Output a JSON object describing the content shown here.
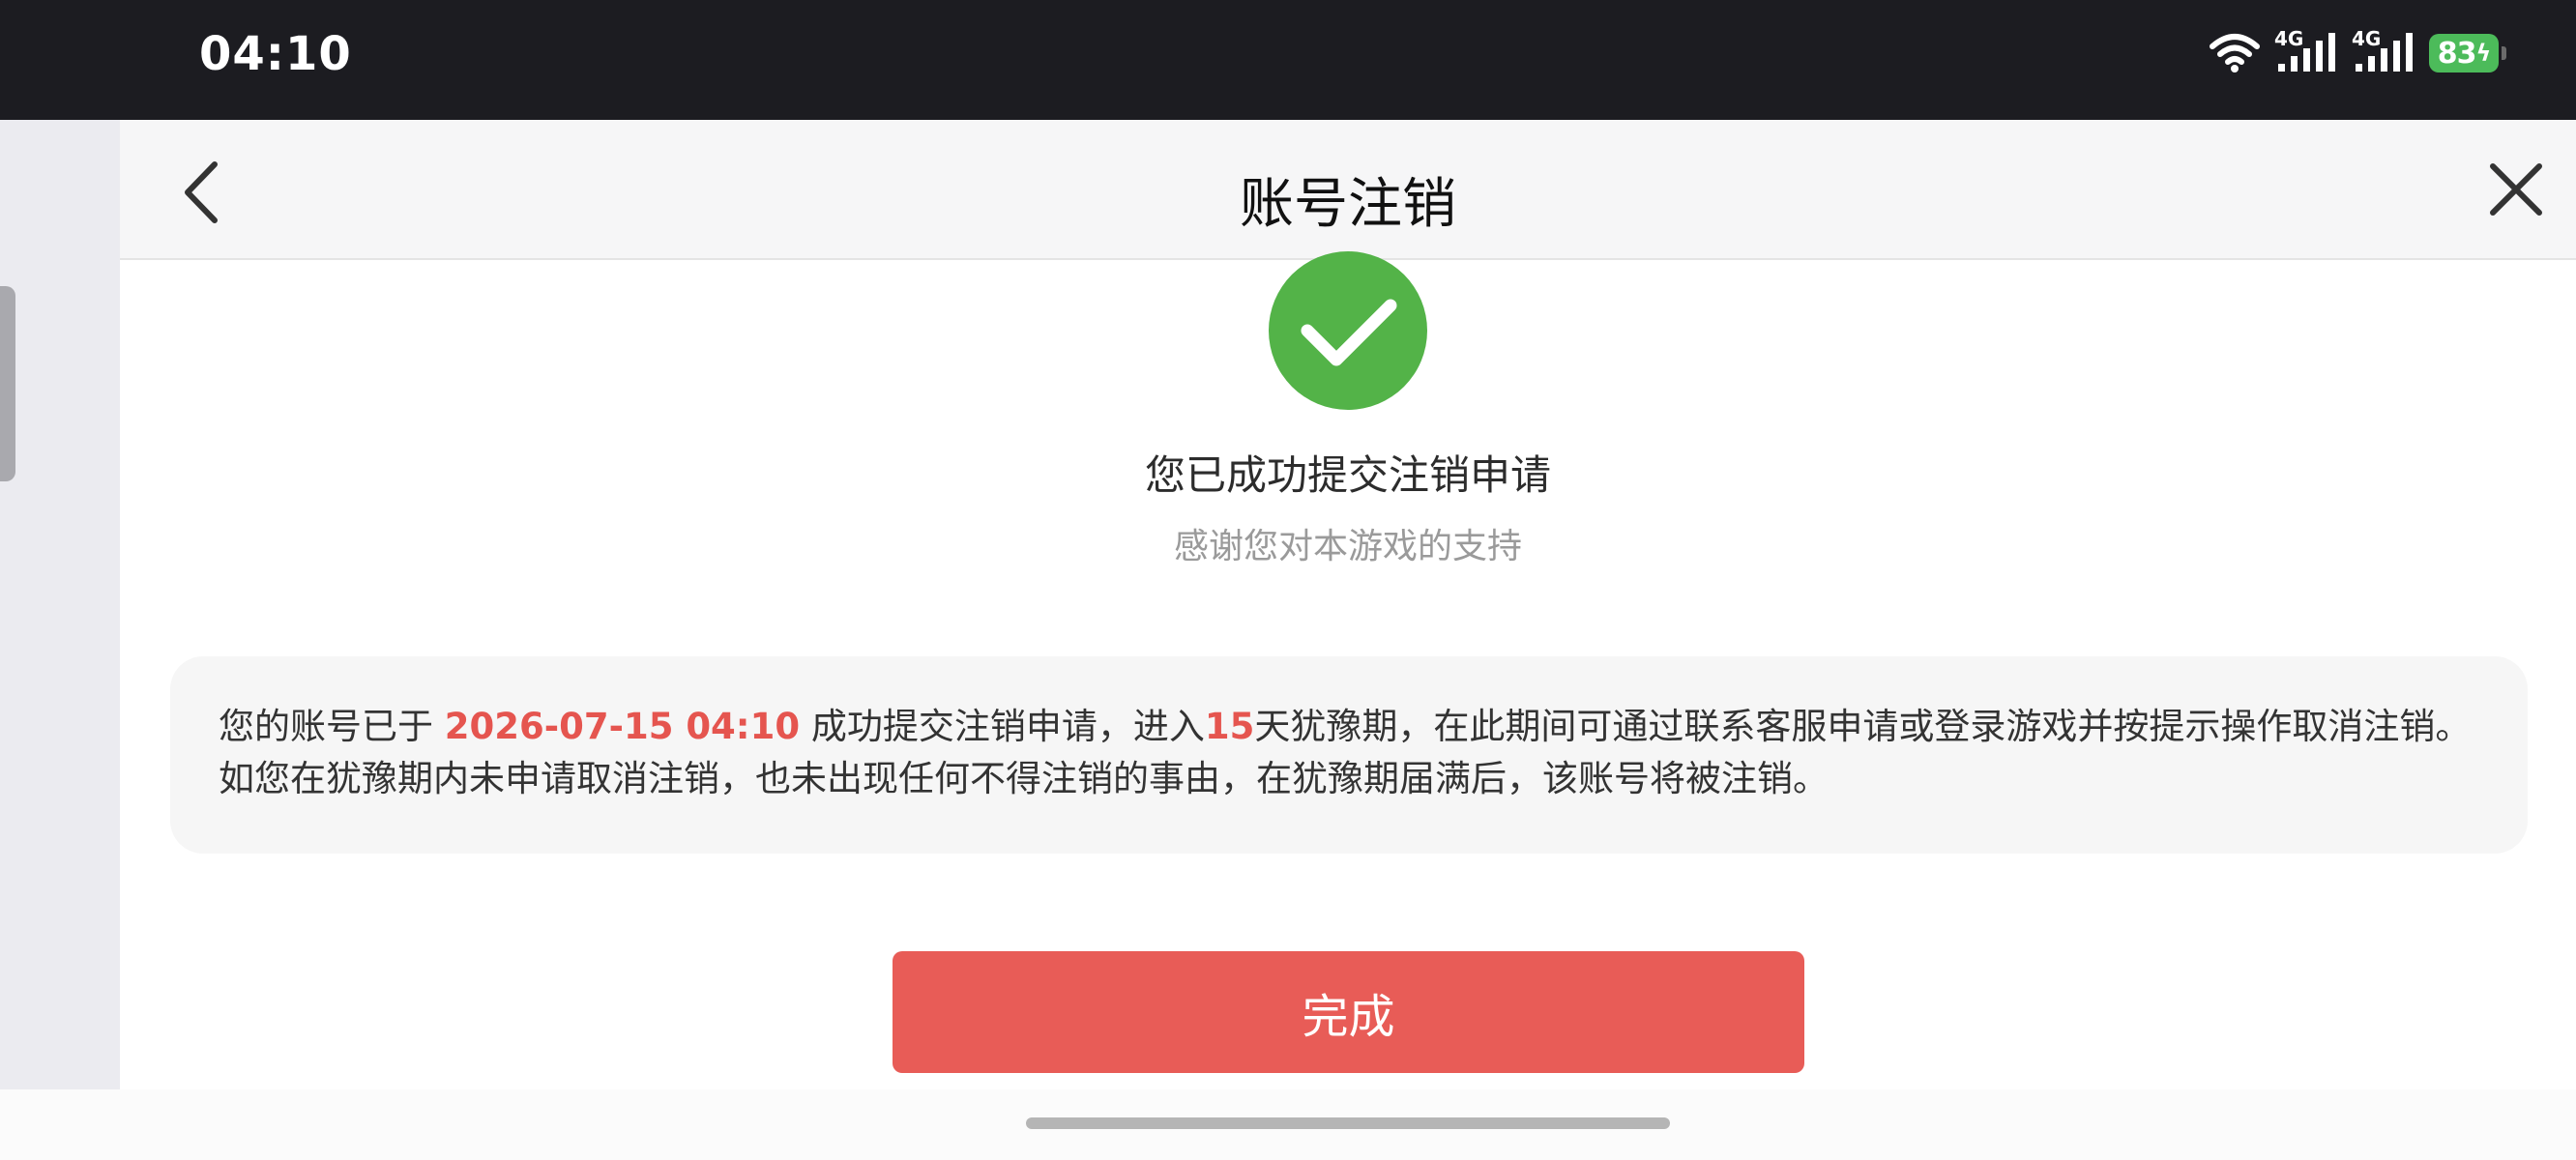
{
  "status_bar": {
    "time": "04:10",
    "network_1": "4G",
    "network_2": "4G",
    "battery": "83"
  },
  "header": {
    "title": "账号注销",
    "back_icon": "chevron-left-icon",
    "close_icon": "close-icon"
  },
  "success": {
    "icon": "check-circle-icon",
    "icon_color": "#53b348",
    "title": "您已成功提交注销申请",
    "subtitle": "感谢您对本游戏的支持"
  },
  "notice": {
    "prefix": "您的账号已于 ",
    "datetime": "2026-07-15 04:10",
    "middle": " 成功提交注销申请，进入",
    "days": "15",
    "suffix": "天犹豫期，在此期间可通过联系客服申请或登录游戏并按提示操作取消注销。如您在犹豫期内未申请取消注销，也未出现任何不得注销的事由，在犹豫期届满后，该账号将被注销。",
    "highlight_color": "#e5554f"
  },
  "done_button": {
    "label": "完成",
    "color": "#e85c57"
  }
}
